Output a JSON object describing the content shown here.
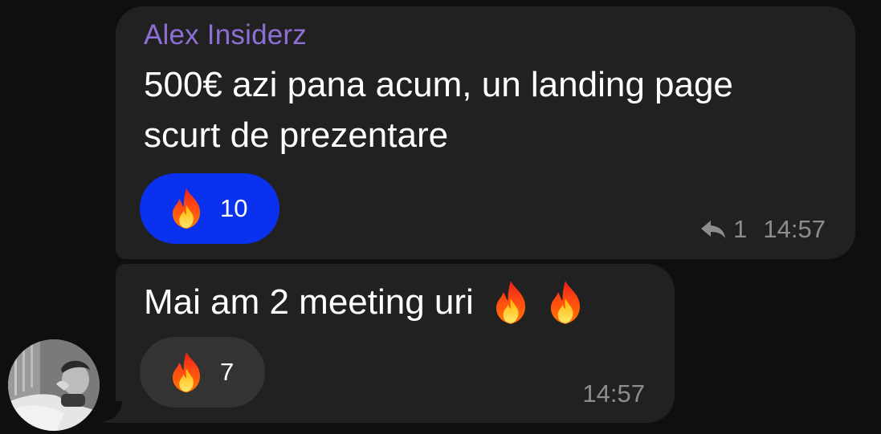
{
  "messages": [
    {
      "sender": "Alex Insiderz",
      "text_lines": [
        "500€ azi pana acum, un landing page",
        "scurt de prezentare"
      ],
      "reaction": {
        "emoji": "fire-emoji",
        "count": "10",
        "selected": true
      },
      "reply_count": "1",
      "time": "14:57"
    },
    {
      "text": "Mai am 2 meeting uri",
      "text_emojis": [
        "fire-emoji",
        "fire-emoji"
      ],
      "reaction": {
        "emoji": "fire-emoji",
        "count": "7",
        "selected": false
      },
      "time": "14:57"
    }
  ],
  "colors": {
    "background": "#0f0f0f",
    "bubble": "#212121",
    "sender_name": "#8e6fd6",
    "reaction_active": "#0a32ee",
    "reaction_inactive": "#333333",
    "meta_text": "#8d8d8d"
  },
  "icons": [
    "reply-icon",
    "fire-emoji",
    "avatar-photo"
  ]
}
